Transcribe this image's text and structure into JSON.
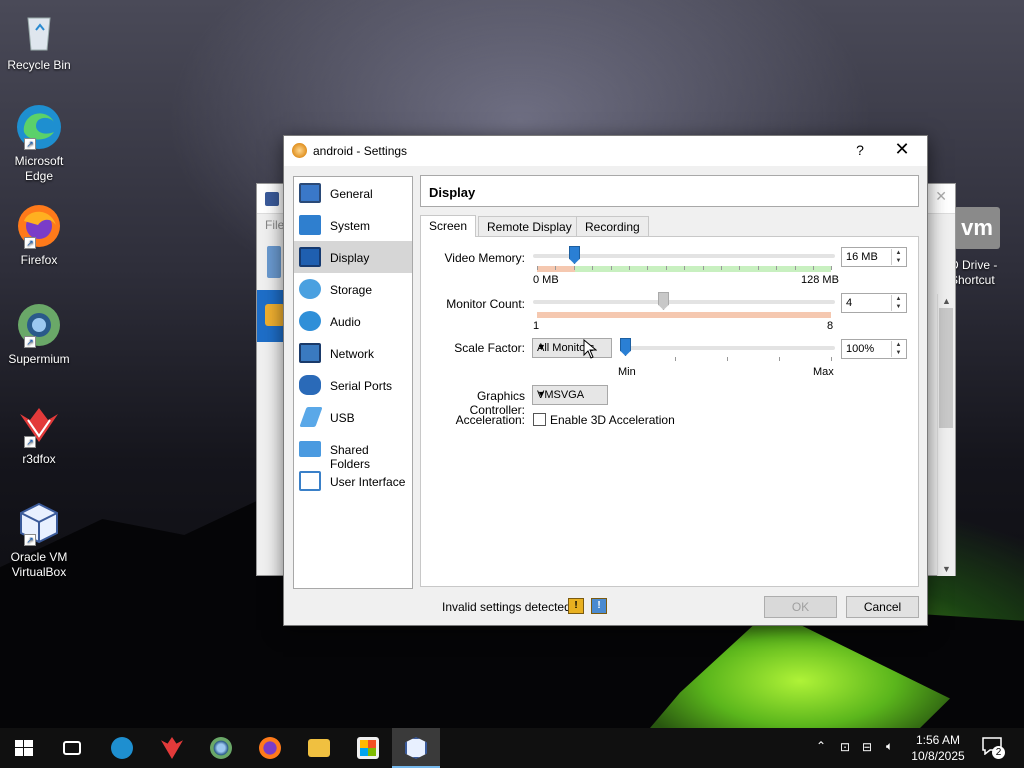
{
  "desktop": {
    "icons": [
      {
        "label": "Recycle Bin",
        "icon": "recycle-bin-icon"
      },
      {
        "label": "Microsoft Edge",
        "icon": "edge-icon"
      },
      {
        "label": "Firefox",
        "icon": "firefox-icon"
      },
      {
        "label": "Supermium",
        "icon": "supermium-icon"
      },
      {
        "label": "r3dfox",
        "icon": "r3dfox-icon"
      },
      {
        "label": "Oracle VM VirtualBox",
        "icon": "virtualbox-icon"
      }
    ],
    "right_icon_label": "D Drive - Shortcut",
    "right_icon_text": "vm"
  },
  "background_window": {
    "menu_file": "File"
  },
  "dialog": {
    "title": "android - Settings",
    "help": "?",
    "close": "✕",
    "categories": [
      {
        "label": "General",
        "icon": "general-icon",
        "color": "#3a78c8"
      },
      {
        "label": "System",
        "icon": "system-icon",
        "color": "#2f7fcf"
      },
      {
        "label": "Display",
        "icon": "display-icon",
        "color": "#1f5fb0"
      },
      {
        "label": "Storage",
        "icon": "storage-icon",
        "color": "#4aa0e0"
      },
      {
        "label": "Audio",
        "icon": "audio-icon",
        "color": "#2f8fd8"
      },
      {
        "label": "Network",
        "icon": "network-icon",
        "color": "#3a7ac0"
      },
      {
        "label": "Serial Ports",
        "icon": "serial-ports-icon",
        "color": "#2a6ab8"
      },
      {
        "label": "USB",
        "icon": "usb-icon",
        "color": "#5aa8e8"
      },
      {
        "label": "Shared Folders",
        "icon": "shared-folders-icon",
        "color": "#4a9ae0"
      },
      {
        "label": "User Interface",
        "icon": "user-interface-icon",
        "color": "#3a80c8"
      }
    ],
    "selected_category": "Display",
    "page_title": "Display",
    "tabs": [
      "Screen",
      "Remote Display",
      "Recording"
    ],
    "active_tab": "Screen",
    "video_memory": {
      "label": "Video Memory:",
      "value": "16 MB",
      "min": "0 MB",
      "max": "128 MB",
      "level": 0.125
    },
    "monitor_count": {
      "label": "Monitor Count:",
      "value": "4",
      "min": "1",
      "max": "8",
      "level": 0.43
    },
    "scale_factor": {
      "label": "Scale Factor:",
      "combo": "All Monitors",
      "value": "100%",
      "min": "Min",
      "max": "Max",
      "level": 0
    },
    "graphics_controller": {
      "label": "Graphics Controller:",
      "value": "VMSVGA"
    },
    "acceleration": {
      "label": "Acceleration:",
      "checkbox": "Enable 3D Acceleration",
      "checked": false
    },
    "footer_text": "Invalid settings detected",
    "ok": "OK",
    "cancel": "Cancel"
  },
  "taskbar": {
    "items": [
      "start",
      "task-view",
      "edge",
      "r3dfox",
      "supermium",
      "firefox",
      "file-explorer",
      "store",
      "virtualbox"
    ],
    "time": "1:56 AM",
    "date": "10/8/2025",
    "notification_count": "2"
  }
}
